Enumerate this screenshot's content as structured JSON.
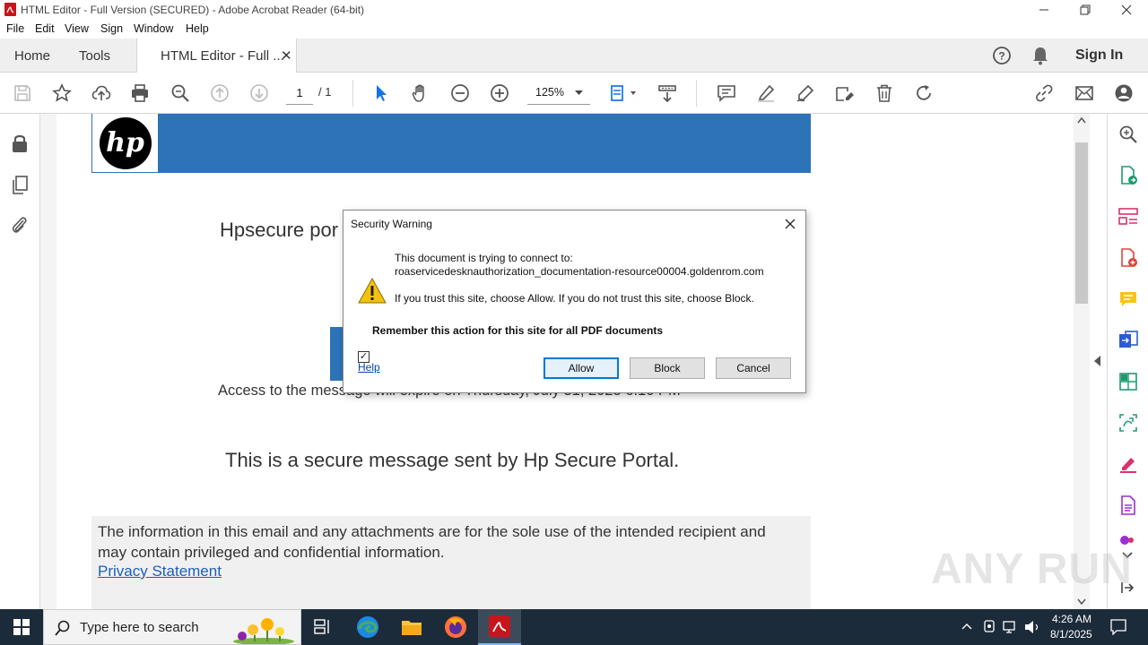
{
  "window": {
    "title": "HTML Editor - Full Version (SECURED) - Adobe Acrobat Reader (64-bit)",
    "controls": [
      "minimize-icon",
      "maximize-icon",
      "close-icon"
    ]
  },
  "menu": [
    "File",
    "Edit",
    "View",
    "Sign",
    "Window",
    "Help"
  ],
  "tabs": {
    "home": "Home",
    "tools": "Tools",
    "document": "HTML Editor - Full ...",
    "sign_in": "Sign In"
  },
  "toolbar": {
    "page_current": "1",
    "page_total": "/ 1",
    "zoom": "125%"
  },
  "document": {
    "portal_heading": "Hpsecure por",
    "expiry_text": "Access to the message will expire on Thursday, July 31, 2025 6:10 PM",
    "secure_message": "This is a secure message sent by Hp Secure Portal.",
    "disclaimer": "The information in this email and any attachments are for the sole use of the intended recipient and may contain privileged and confidential information.",
    "privacy_link": "Privacy Statement",
    "logo_text": "hp"
  },
  "dialog": {
    "title": "Security Warning",
    "line1": "This document is trying to connect to:",
    "url": "roaservicedesknauthorization_documentation-resource00004.goldenrom.com",
    "line2": "If you trust this site, choose Allow. If you do not trust this site, choose Block.",
    "remember_label": "Remember this action for this site for all PDF documents",
    "remember_checked": true,
    "help": "Help",
    "allow": "Allow",
    "block": "Block",
    "cancel": "Cancel"
  },
  "taskbar": {
    "search_placeholder": "Type here to search",
    "time": "4:26 AM",
    "date": "8/1/2025"
  },
  "watermark": "ANY RUN",
  "colors": {
    "banner_blue": "#2d73b8",
    "taskbar": "#1c2b3a",
    "accent_blue": "#1473e6",
    "adobe_red": "#c4161c"
  }
}
